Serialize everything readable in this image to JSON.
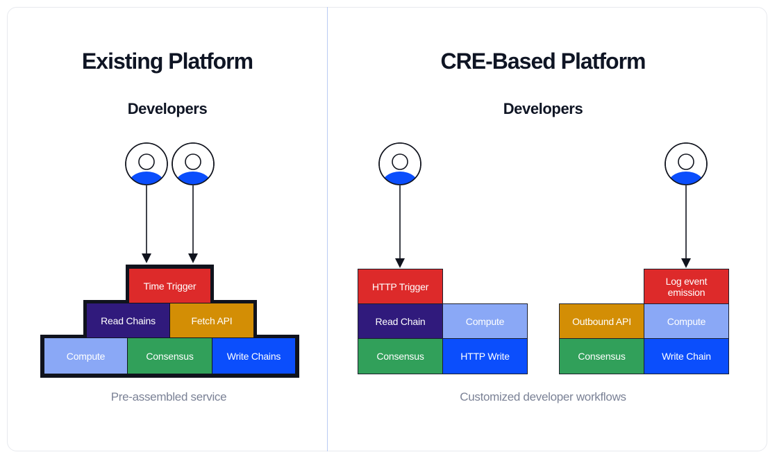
{
  "colors": {
    "trigger_red": "#dd2a2a",
    "indigo": "#301a7c",
    "amber": "#d38e05",
    "light_blue": "#8aa8f6",
    "green": "#31a05a",
    "blue": "#0b4efc",
    "frame": "#10131d",
    "caption_gray": "#7b8296",
    "divider": "#b9cbf3"
  },
  "left_panel": {
    "title": "Existing Platform",
    "subtitle": "Developers",
    "developers": [
      {
        "icon": "user-icon"
      },
      {
        "icon": "user-icon"
      }
    ],
    "pyramid": {
      "top_row": [
        {
          "label": "Time Trigger",
          "color": "trigger_red"
        }
      ],
      "middle_row": [
        {
          "label": "Read Chains",
          "color": "indigo"
        },
        {
          "label": "Fetch API",
          "color": "amber"
        }
      ],
      "bottom_row": [
        {
          "label": "Compute",
          "color": "light_blue"
        },
        {
          "label": "Consensus",
          "color": "green"
        },
        {
          "label": "Write Chains",
          "color": "blue"
        }
      ]
    },
    "caption": "Pre-assembled service"
  },
  "right_panel": {
    "title": "CRE-Based Platform",
    "subtitle": "Developers",
    "workflow_a": {
      "developer_icon": "user-icon",
      "blocks": [
        {
          "label": "HTTP Trigger",
          "color": "trigger_red"
        },
        {
          "label": "Read Chain",
          "color": "indigo"
        },
        {
          "label": "Compute",
          "color": "light_blue"
        },
        {
          "label": "Consensus",
          "color": "green"
        },
        {
          "label": "HTTP Write",
          "color": "blue"
        }
      ]
    },
    "workflow_b": {
      "developer_icon": "user-icon",
      "blocks": [
        {
          "label": "Log event emission",
          "color": "trigger_red"
        },
        {
          "label": "Outbound API",
          "color": "amber"
        },
        {
          "label": "Compute",
          "color": "light_blue"
        },
        {
          "label": "Consensus",
          "color": "green"
        },
        {
          "label": "Write Chain",
          "color": "blue"
        }
      ]
    },
    "caption": "Customized developer workflows"
  }
}
